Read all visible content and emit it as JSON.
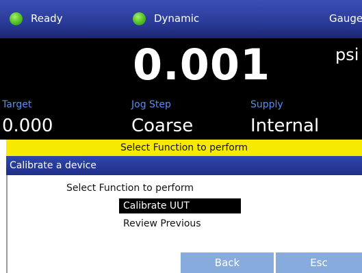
{
  "status_bar": {
    "items": [
      {
        "label": "Ready",
        "led_color": "#5cc82c"
      },
      {
        "label": "Dynamic",
        "led_color": "#5cc82c"
      },
      {
        "label": "Gauge"
      }
    ]
  },
  "readout": {
    "value": "0.001",
    "unit": "psi",
    "fields": [
      {
        "label": "Target",
        "value": "0.000"
      },
      {
        "label": "Jog Step",
        "value": "Coarse"
      },
      {
        "label": "Supply",
        "value": "Internal"
      }
    ]
  },
  "prompt": "Select Function to perform",
  "dialog": {
    "title": "Calibrate a device",
    "heading": "Select Function to perform",
    "options": [
      {
        "label": "Calibrate UUT",
        "selected": true
      },
      {
        "label": "Review Previous",
        "selected": false
      }
    ],
    "buttons": {
      "back": "Back",
      "esc": "Esc"
    }
  },
  "colors": {
    "status_bar": "#2a3a98",
    "field_label": "#5b8ef0",
    "prompt_bar": "#f6ea00",
    "button": "#87abdd"
  }
}
